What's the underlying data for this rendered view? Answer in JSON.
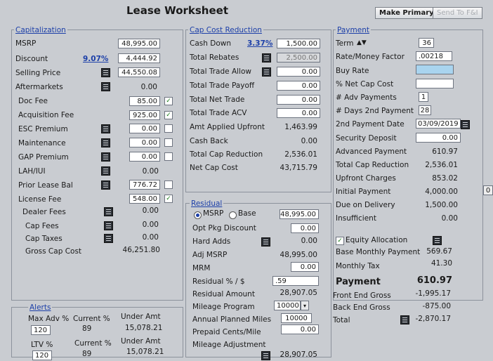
{
  "title": "Lease Worksheet",
  "buttons": {
    "make_primary": "Make Primary",
    "send_fi": "Send To F&I"
  },
  "capitalization": {
    "title": "Capitalization",
    "msrp": {
      "label": "MSRP",
      "value": "48,995.00"
    },
    "discount": {
      "label": "Discount",
      "pct": "9.07%",
      "value": "4,444.92"
    },
    "selling_price": {
      "label": "Selling Price",
      "value": "44,550.08"
    },
    "aftermarkets": {
      "label": "Aftermarkets",
      "value": "0.00"
    },
    "doc_fee": {
      "label": "Doc Fee",
      "value": "85.00"
    },
    "acquisition_fee": {
      "label": "Acquisition Fee",
      "value": "925.00"
    },
    "esc_premium": {
      "label": "ESC Premium",
      "value": "0.00"
    },
    "maintenance": {
      "label": "Maintenance",
      "value": "0.00"
    },
    "gap_premium": {
      "label": "GAP Premium",
      "value": "0.00"
    },
    "lah": {
      "label": "LAH/IUI",
      "value": "0.00"
    },
    "prior_lease_bal": {
      "label": "Prior Lease Bal",
      "value": "776.72"
    },
    "license_fee": {
      "label": "License Fee",
      "value": "548.00"
    },
    "dealer_fees": {
      "label": "Dealer Fees",
      "value": "0.00"
    },
    "cap_fees": {
      "label": "Cap Fees",
      "value": "0.00"
    },
    "cap_taxes": {
      "label": "Cap Taxes",
      "value": "0.00"
    },
    "gross_cap_cost": {
      "label": "Gross Cap Cost",
      "value": "46,251.80"
    }
  },
  "alerts": {
    "title": "Alerts",
    "h1": "Max Adv %",
    "h2": "Current %",
    "h3": "Under Amt",
    "r1": [
      "120",
      "89",
      "15,078.21"
    ],
    "h4": "LTV %",
    "h5": "Current %",
    "h6": "Under Amt",
    "r2": [
      "120",
      "89",
      "15,078.21"
    ]
  },
  "cap_cost_reduction": {
    "title": "Cap Cost Reduction",
    "cash_down": {
      "label": "Cash Down",
      "pct": "3.37%",
      "value": "1,500.00"
    },
    "total_rebates": {
      "label": "Total Rebates",
      "value": "2,500.00"
    },
    "total_trade_allow": {
      "label": "Total Trade Allow",
      "value": "0.00"
    },
    "total_trade_payoff": {
      "label": "Total Trade Payoff",
      "value": "0.00"
    },
    "total_net_trade": {
      "label": "Total Net Trade",
      "value": "0.00"
    },
    "total_trade_acv": {
      "label": "Total Trade ACV",
      "value": "0.00"
    },
    "amt_applied_upfront": {
      "label": "Amt Applied Upfront",
      "value": "1,463.99"
    },
    "cash_back": {
      "label": "Cash Back",
      "value": "0.00"
    },
    "total_cap_reduction": {
      "label": "Total Cap Reduction",
      "value": "2,536.01"
    },
    "net_cap_cost": {
      "label": "Net Cap Cost",
      "value": "43,715.79"
    }
  },
  "residual": {
    "title": "Residual",
    "msrp_option": "MSRP",
    "base_option": "Base",
    "msrp_value": "48,995.00",
    "opt_pkg_discount": {
      "label": "Opt Pkg Discount",
      "value": "0.00"
    },
    "hard_adds": {
      "label": "Hard Adds",
      "value": "0.00"
    },
    "adj_msrp": {
      "label": "Adj MSRP",
      "value": "48,995.00"
    },
    "mrm": {
      "label": "MRM",
      "value": "0.00"
    },
    "residual_pct": {
      "label": "Residual % / $",
      "value": ".59"
    },
    "residual_amount": {
      "label": "Residual Amount",
      "value": "28,907.05"
    },
    "mileage_program": {
      "label": "Mileage Program",
      "value": "10000"
    },
    "annual_planned_miles": {
      "label": "Annual Planned Miles",
      "value": "10000"
    },
    "prepaid_cents": {
      "label": "Prepaid Cents/Mile",
      "value": "0.00"
    },
    "mileage_adjustment": {
      "label": "Mileage Adjustment",
      "value": ""
    },
    "adj_residual_value": "28,907.05"
  },
  "payment": {
    "title": "Payment",
    "term": {
      "label": "Term",
      "value": "36"
    },
    "rate_money_factor": {
      "label": "Rate/Money Factor",
      "value": ".00218"
    },
    "buy_rate": {
      "label": "Buy Rate",
      "value": ""
    },
    "net_cap_cost_pct": {
      "label": "% Net Cap Cost",
      "value": ""
    },
    "adv_payments": {
      "label": "# Adv Payments",
      "value": "1"
    },
    "days_2nd_payment": {
      "label": "# Days 2nd Payment",
      "value": "28"
    },
    "second_payment_date": {
      "label": "2nd Payment Date",
      "value": "03/09/2019"
    },
    "security_deposit": {
      "label": "Security Deposit",
      "value": "0.00"
    },
    "advanced_payment": {
      "label": "Advanced Payment",
      "value": "610.97"
    },
    "total_cap_reduction": {
      "label": "Total Cap Reduction",
      "value": "2,536.01"
    },
    "upfront_charges": {
      "label": "Upfront Charges",
      "value": "853.02"
    },
    "initial_payment": {
      "label": "Initial Payment",
      "value": "4,000.00"
    },
    "due_on_delivery": {
      "label": "Due on Delivery",
      "value": "1,500.00"
    },
    "insufficient": {
      "label": "Insufficient",
      "value": "0.00"
    },
    "equity_allocation": {
      "label": "Equity Allocation"
    },
    "base_monthly_payment": {
      "label": "Base Monthly Payment",
      "value": "569.67"
    },
    "monthly_tax": {
      "label": "Monthly Tax",
      "value": "41.30"
    },
    "payment_total": {
      "label": "Payment",
      "value": "610.97"
    },
    "front_end_gross": {
      "label": "Front End Gross",
      "value": "-1,995.17"
    },
    "back_end_gross": {
      "label": "Back End Gross",
      "value": "-875.00"
    },
    "total": {
      "label": "Total",
      "value": "-2,870.17"
    }
  },
  "edge_value": "0"
}
